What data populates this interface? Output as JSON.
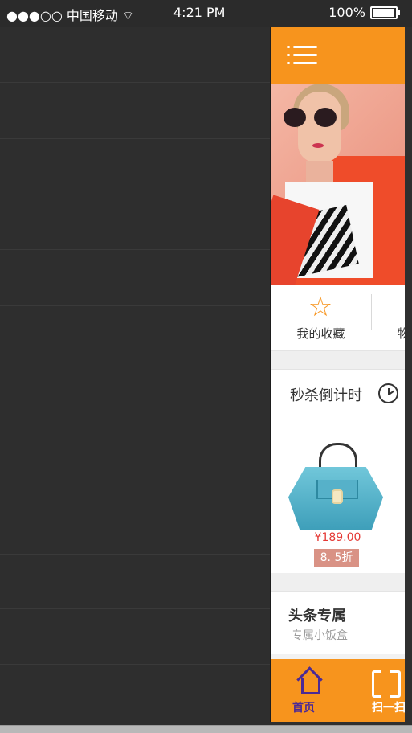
{
  "status_bar": {
    "signal": "●●●○○",
    "carrier": "中国移动",
    "wifi_icon": "wifi-icon",
    "time": "4:21 PM",
    "battery_pct": "100%"
  },
  "app": {
    "header": {
      "menu_icon": "hamburger-icon"
    },
    "quick_actions": [
      {
        "label": "我的收藏",
        "icon": "star-icon"
      },
      {
        "label": "物"
      }
    ],
    "countdown": {
      "title": "秒杀倒计时",
      "icon": "alarm-clock-icon"
    },
    "product": {
      "price": "¥189.00",
      "discount": "8. 5折"
    },
    "headline": {
      "title": "头条专属",
      "subtitle": "专属小饭盒"
    },
    "bottom_nav": [
      {
        "label": "首页",
        "icon": "home-icon"
      },
      {
        "label": "扫一扫",
        "icon": "scan-icon"
      }
    ]
  },
  "colors": {
    "accent": "#f7941d",
    "nav_active": "#4b2a95",
    "price": "#e53935",
    "discount_bg": "#d99285",
    "dark_panel": "#2e2e2e"
  }
}
